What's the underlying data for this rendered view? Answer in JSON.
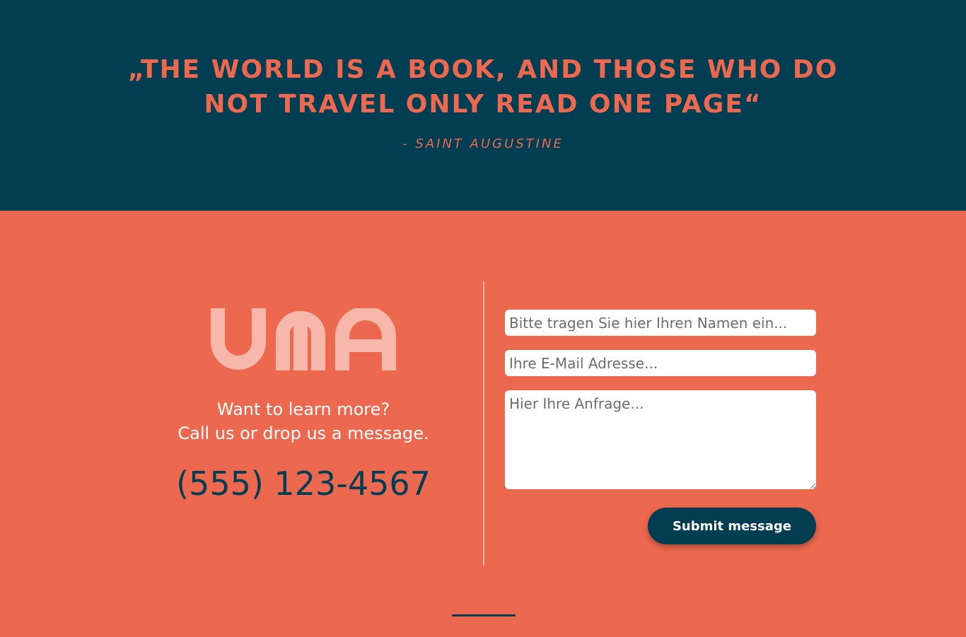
{
  "quote": {
    "line1": "„The world is a book, and those who do",
    "line2": "not travel only read one page“",
    "author": "- Saint Augustine"
  },
  "brand": {
    "logo_text": "UMA"
  },
  "contact": {
    "tagline_line1": "Want to learn more?",
    "tagline_line2": "Call us or drop us a message.",
    "phone": "(555) 123-4567"
  },
  "form": {
    "name_placeholder": "Bitte tragen Sie hier Ihren Namen ein...",
    "email_placeholder": "Ihre E-Mail Adresse...",
    "message_placeholder": "Hier Ihre Anfrage...",
    "submit_label": "Submit message"
  },
  "colors": {
    "navy": "#023e51",
    "coral": "#ec684e",
    "logo_pink": "#f7b7aa"
  }
}
